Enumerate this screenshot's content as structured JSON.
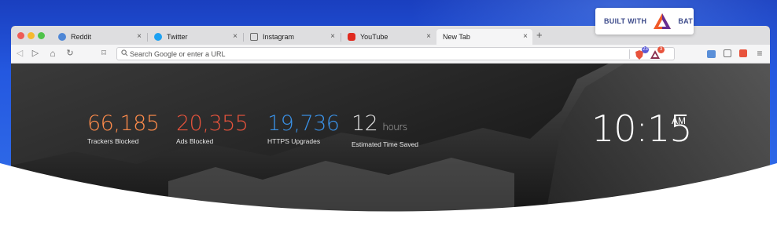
{
  "badge": {
    "prefix": "BUILT WITH",
    "brand": "BAT"
  },
  "tabs": [
    {
      "label": "Reddit",
      "icon": "reddit-icon",
      "color": "#4f87d6",
      "close": "×"
    },
    {
      "label": "Twitter",
      "icon": "twitter-icon",
      "color": "#1da1f2",
      "close": "×"
    },
    {
      "label": "Instagram",
      "icon": "instagram-icon",
      "color": "#6b6b6b",
      "close": "×"
    },
    {
      "label": "YouTube",
      "icon": "youtube-icon",
      "color": "#e02b20",
      "close": "×"
    },
    {
      "label": "New Tab",
      "icon": "",
      "color": "",
      "close": "×",
      "active": true
    }
  ],
  "new_tab_button": "+",
  "toolbar": {
    "back": "◁",
    "forward": "▷",
    "home": "⌂",
    "reload": "↻",
    "bookmark": "⌑",
    "url_placeholder": "Search Google or enter a URL",
    "shields_count": "23",
    "rewards_count": "3",
    "menu": "≡"
  },
  "stats": [
    {
      "value": "66,185",
      "label": "Trackers Blocked",
      "color": "#ff8c4b"
    },
    {
      "value": "20,355",
      "label": "Ads Blocked",
      "color": "#e8533c"
    },
    {
      "value": "19,736",
      "label": "HTTPS Upgrades",
      "color": "#3a92e8"
    },
    {
      "value": "12",
      "unit": "hours",
      "label": "Estimated Time Saved",
      "color": "#dcdcdc"
    }
  ],
  "clock": {
    "time": "10:15",
    "ampm": "AM"
  }
}
